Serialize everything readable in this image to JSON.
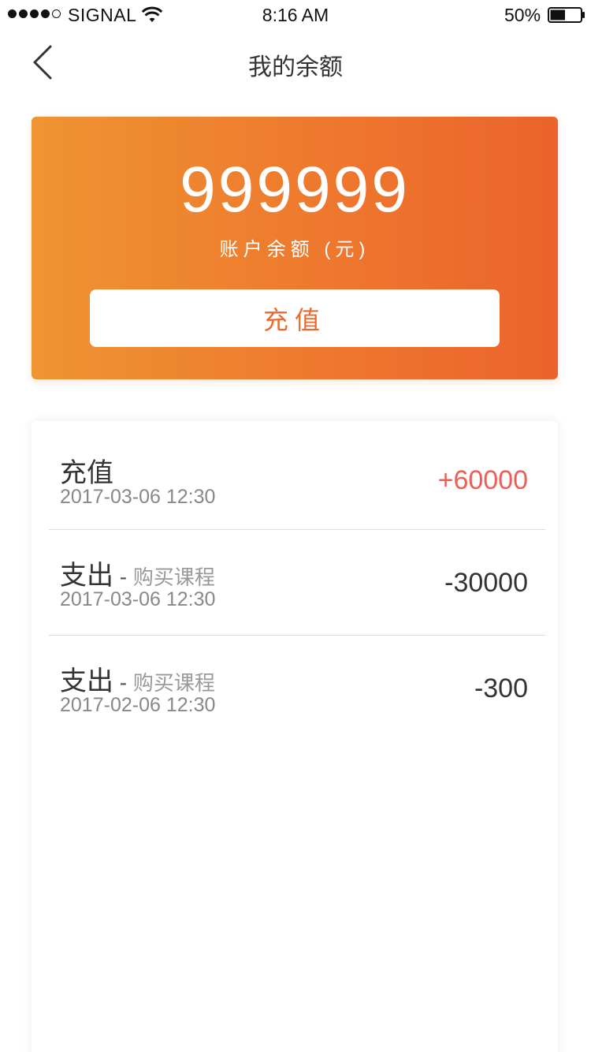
{
  "status_bar": {
    "carrier": "SIGNAL",
    "time": "8:16 AM",
    "battery_percent": "50%",
    "battery_level": 0.5,
    "signal_bars": 4
  },
  "nav": {
    "title": "我的余额"
  },
  "balance": {
    "amount": "999999",
    "label": "账户余额 (元)",
    "recharge_button": "充值"
  },
  "transactions": [
    {
      "type": "充值",
      "sep": "",
      "subtitle": "",
      "date": "2017-03-06  12:30",
      "amount": "+60000",
      "positive": true
    },
    {
      "type": "支出",
      "sep": " - ",
      "subtitle": "购买课程",
      "date": "2017-03-06  12:30",
      "amount": "-30000",
      "positive": false
    },
    {
      "type": "支出",
      "sep": " - ",
      "subtitle": "购买课程",
      "date": "2017-02-06  12:30",
      "amount": "-300",
      "positive": false
    }
  ],
  "colors": {
    "accent_start": "#ef9433",
    "accent_end": "#ec632b",
    "positive_amount": "#ef5d55"
  }
}
